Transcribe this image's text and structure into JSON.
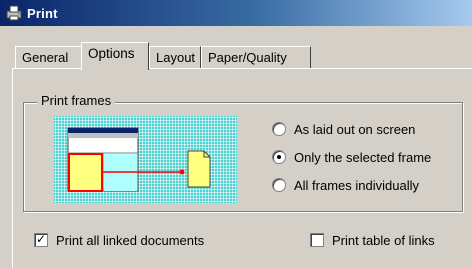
{
  "window": {
    "title": "Print",
    "icon": "printer-icon"
  },
  "tabs": [
    {
      "label": "General"
    },
    {
      "label": "Options",
      "selected": true
    },
    {
      "label": "Layout"
    },
    {
      "label": "Paper/Quality"
    }
  ],
  "print_frames": {
    "title": "Print frames",
    "options": [
      {
        "label": "As laid out on screen",
        "selected": false
      },
      {
        "label": "Only the selected frame",
        "selected": true
      },
      {
        "label": "All frames individually",
        "selected": false
      }
    ]
  },
  "checkboxes": {
    "print_linked": {
      "label": "Print all linked documents",
      "checked": true
    },
    "print_table_links": {
      "label": "Print table of links",
      "checked": false
    }
  },
  "colors": {
    "titlebar_start": "#0a246a",
    "titlebar_end": "#a6caf0",
    "preview_bg": "#53d2d2",
    "frame_highlight": "#ff0000",
    "page_yellow": "#ffff80"
  }
}
